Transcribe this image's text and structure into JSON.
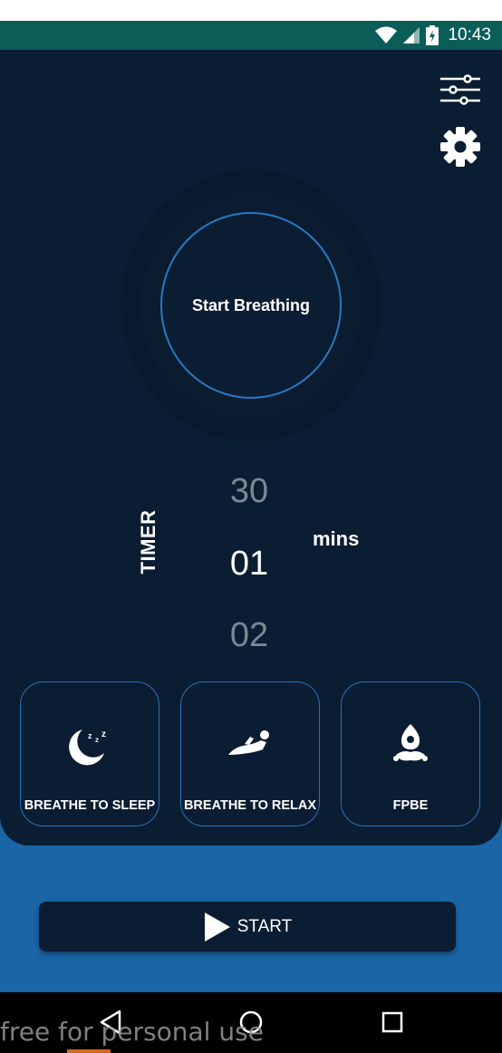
{
  "status_bar": {
    "time": "10:43",
    "icons": [
      "wifi-icon",
      "cell-signal-icon",
      "battery-icon"
    ],
    "color": "#0b5e57"
  },
  "toolbar": {
    "icons": [
      "sliders-icon",
      "gear-icon"
    ]
  },
  "breath_button": {
    "label": "Start Breathing"
  },
  "timer": {
    "label": "TIMER",
    "values": {
      "prev": "30",
      "current": "01",
      "next": "02"
    },
    "unit": "mins"
  },
  "modes": [
    {
      "label": "BREATHE TO SLEEP",
      "icon": "moon-sleep-icon"
    },
    {
      "label": "BREATHE TO RELAX",
      "icon": "reclining-person-icon"
    },
    {
      "label": "FPBE",
      "icon": "meditation-icon"
    }
  ],
  "start_button": {
    "label": "START",
    "icon": "play-icon"
  },
  "nav_bar": {
    "icons": [
      "back-icon",
      "home-icon",
      "recents-icon"
    ]
  },
  "watermark": {
    "text": "free for personal use"
  },
  "colors": {
    "panel": "#0b1d33",
    "accent_blue": "#1a65a6",
    "ring": "#2a78c0"
  }
}
